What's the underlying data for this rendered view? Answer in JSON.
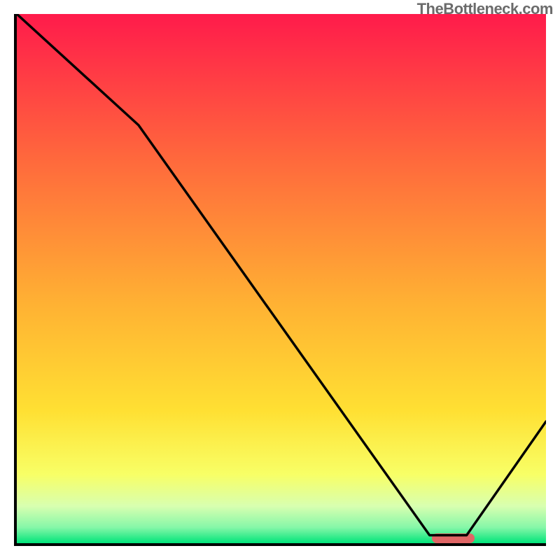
{
  "watermark": "TheBottleneck.com",
  "chart_data": {
    "type": "line",
    "title": "",
    "xlabel": "",
    "ylabel": "",
    "xlim": [
      0,
      100
    ],
    "ylim": [
      0,
      100
    ],
    "series": [
      {
        "name": "curve",
        "x": [
          0,
          23,
          78,
          85,
          100
        ],
        "values": [
          100,
          79,
          1.5,
          1.5,
          23
        ]
      }
    ],
    "marker": {
      "x_start": 78,
      "x_end": 86,
      "y": 1.5
    },
    "gradient_stops": [
      {
        "pct": 0,
        "color": "#ff1b4b"
      },
      {
        "pct": 28,
        "color": "#ff6a3c"
      },
      {
        "pct": 55,
        "color": "#ffb233"
      },
      {
        "pct": 75,
        "color": "#ffe033"
      },
      {
        "pct": 87,
        "color": "#f8ff66"
      },
      {
        "pct": 93,
        "color": "#d8ffb0"
      },
      {
        "pct": 97,
        "color": "#86f7a8"
      },
      {
        "pct": 100,
        "color": "#00e47a"
      }
    ]
  }
}
